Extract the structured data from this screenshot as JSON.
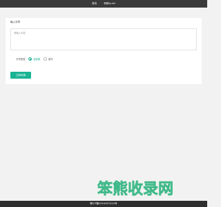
{
  "nav": {
    "home": "首页",
    "title": "转换ip.txt"
  },
  "form": {
    "input_label": "输入字符",
    "textarea_placeholder": "请输入内容",
    "type_label": "字符类型",
    "options": [
      {
        "label": "全部换",
        "checked": true
      },
      {
        "label": "首字",
        "checked": false
      }
    ],
    "submit_label": "立即转换"
  },
  "watermark": {
    "text": "笨熊收录网"
  },
  "footer": {
    "icp": "豫ICP备2024007424号"
  },
  "colors": {
    "accent": "#1ab394",
    "watermark": "#5bd4a4",
    "topbar": "#3a3a3a",
    "footer": "#2f2f2f"
  }
}
